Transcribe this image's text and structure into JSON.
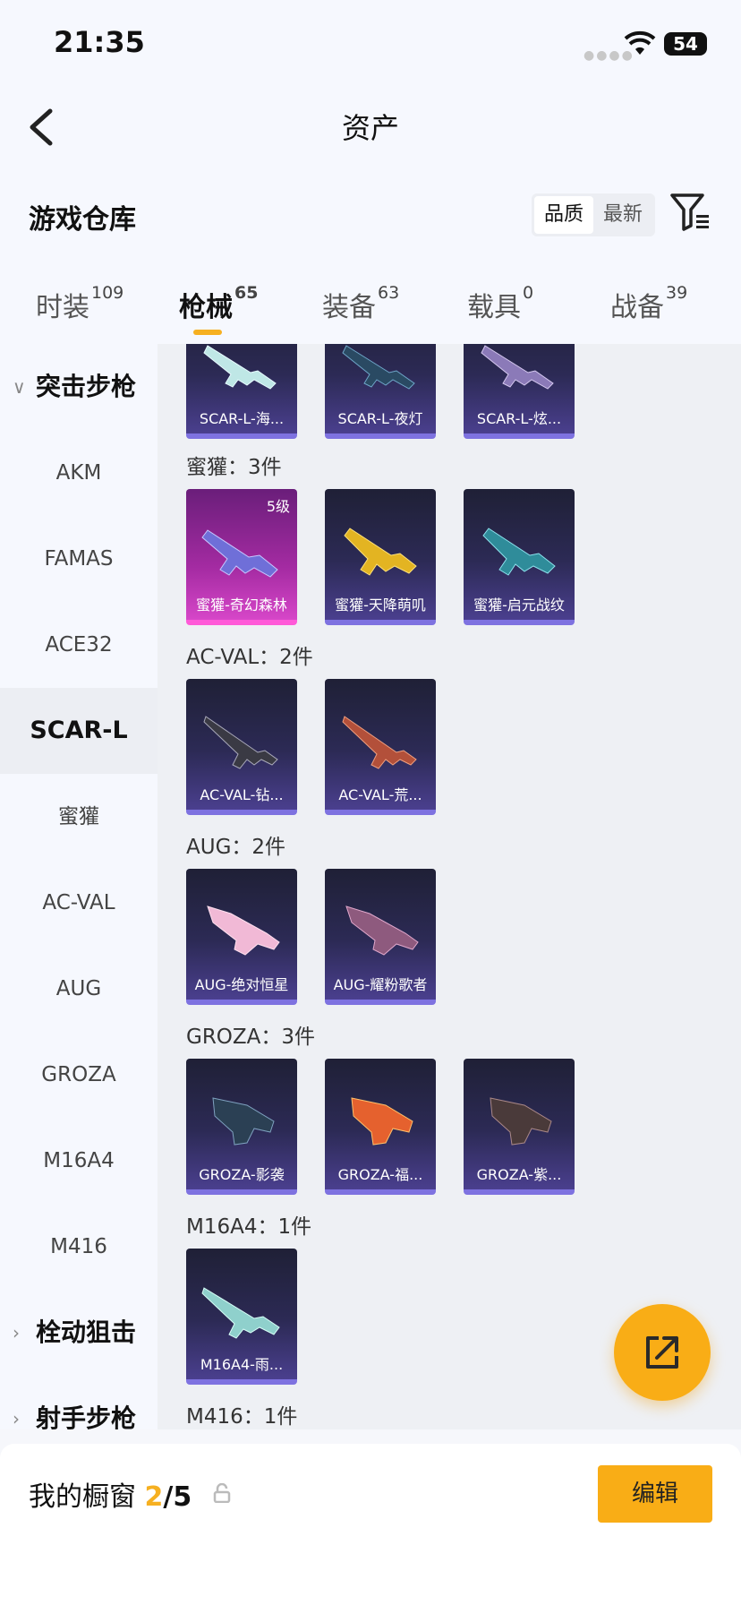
{
  "status_bar": {
    "time": "21:35",
    "battery": "54"
  },
  "header": {
    "title": "资产",
    "section_title": "游戏仓库",
    "sort_options": [
      "品质",
      "最新"
    ]
  },
  "tabs": [
    {
      "label": "时装",
      "count": "109"
    },
    {
      "label": "枪械",
      "count": "65"
    },
    {
      "label": "装备",
      "count": "63"
    },
    {
      "label": "载具",
      "count": "0"
    },
    {
      "label": "战备",
      "count": "39"
    }
  ],
  "sidebar": {
    "group_open": "突击步枪",
    "items": [
      "AKM",
      "FAMAS",
      "ACE32",
      "SCAR-L",
      "蜜獾",
      "AC-VAL",
      "AUG",
      "GROZA",
      "M16A4",
      "M416"
    ],
    "selected": "SCAR-L",
    "groups_closed": [
      "栓动狙击",
      "射手步枪"
    ]
  },
  "main": {
    "scar_cards": [
      "SCAR-L-海...",
      "SCAR-L-夜灯",
      "SCAR-L-炫..."
    ],
    "groups": [
      {
        "label": "蜜獾：3件",
        "cards": [
          {
            "name": "蜜獾-奇幻森林",
            "level": "5级"
          },
          {
            "name": "蜜獾-天降萌叽"
          },
          {
            "name": "蜜獾-启元战纹"
          }
        ]
      },
      {
        "label": "AC-VAL：2件",
        "cards": [
          {
            "name": "AC-VAL-钻..."
          },
          {
            "name": "AC-VAL-荒..."
          }
        ]
      },
      {
        "label": "AUG：2件",
        "cards": [
          {
            "name": "AUG-绝对恒星"
          },
          {
            "name": "AUG-耀粉歌者"
          }
        ]
      },
      {
        "label": "GROZA：3件",
        "cards": [
          {
            "name": "GROZA-影袭"
          },
          {
            "name": "GROZA-福..."
          },
          {
            "name": "GROZA-紫..."
          }
        ]
      },
      {
        "label": "M16A4：1件",
        "cards": [
          {
            "name": "M16A4-雨..."
          }
        ]
      },
      {
        "label": "M416：1件",
        "cards": []
      }
    ]
  },
  "footer": {
    "label": "我的橱窗",
    "count": "2",
    "total": "/5",
    "edit_label": "编辑"
  },
  "colors": {
    "accent": "#f9ad16",
    "card_base": "#2c2a55",
    "card_rare": "#a42ba2"
  }
}
